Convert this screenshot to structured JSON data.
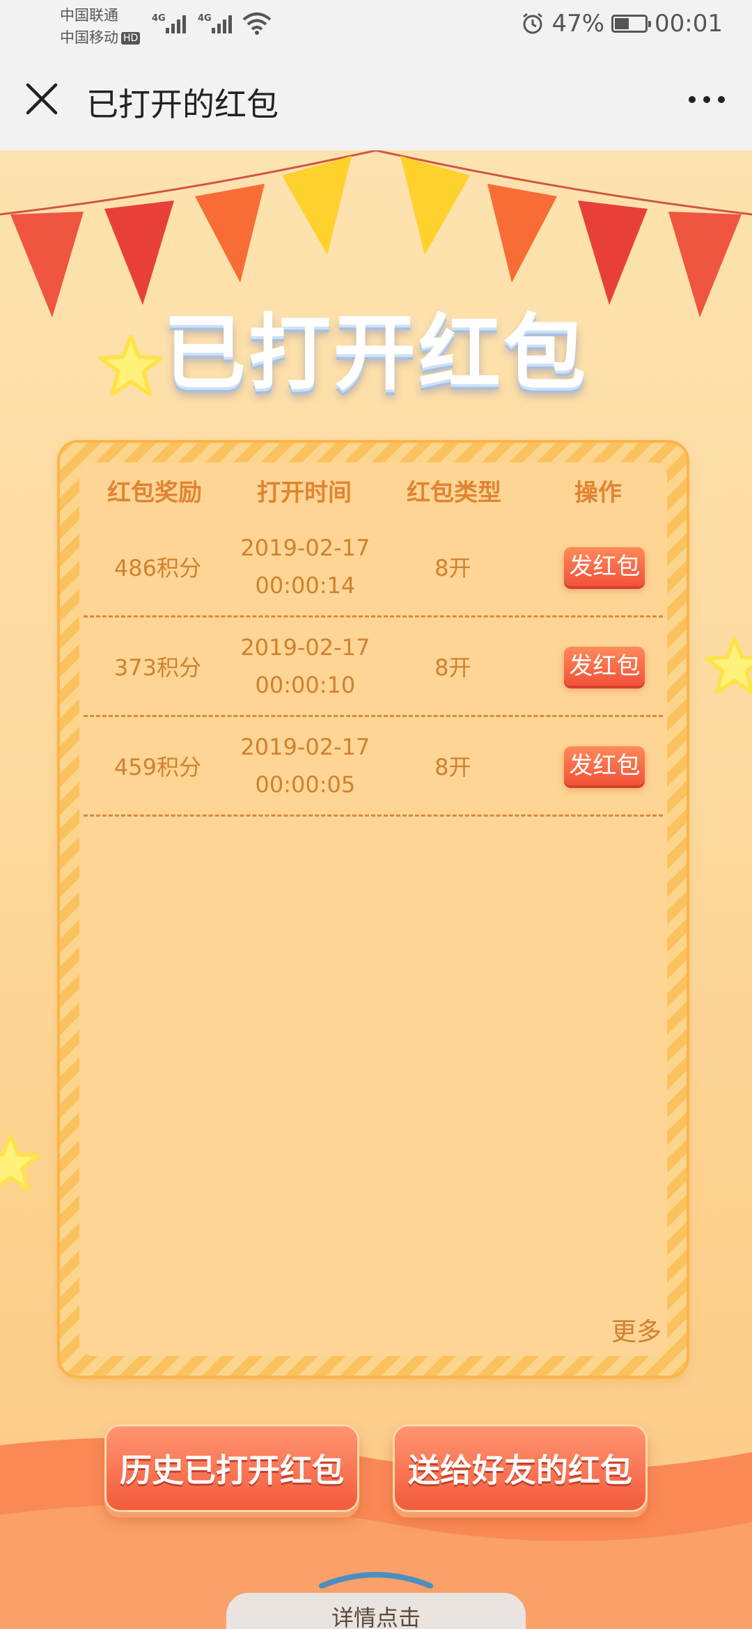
{
  "status_bar": {
    "carrier_1": "中国联通",
    "carrier_2": "中国移动",
    "hd_badge": "HD",
    "battery_percent": "47%",
    "battery_level": 0.47,
    "time": "00:01",
    "network_1": "4G",
    "network_2": "4G"
  },
  "header": {
    "title": "已打开的红包",
    "close_icon": "close-icon",
    "more_icon": "more-dots-icon"
  },
  "banner": {
    "title": "已打开红包"
  },
  "table": {
    "columns": [
      "红包奖励",
      "打开时间",
      "红包类型",
      "操作"
    ],
    "rows": [
      {
        "reward": "486积分",
        "date": "2019-02-17",
        "time": "00:00:14",
        "type": "8开",
        "action": "发红包"
      },
      {
        "reward": "373积分",
        "date": "2019-02-17",
        "time": "00:00:10",
        "type": "8开",
        "action": "发红包"
      },
      {
        "reward": "459积分",
        "date": "2019-02-17",
        "time": "00:00:05",
        "type": "8开",
        "action": "发红包"
      }
    ],
    "more": "更多"
  },
  "actions": {
    "history": "历史已打开红包",
    "sent": "送给好友的红包"
  },
  "footer": {
    "detail": "详情点击"
  },
  "colors": {
    "accent_text": "#d0812e",
    "button_red": "#f2523a",
    "background": "#fcd79a"
  }
}
